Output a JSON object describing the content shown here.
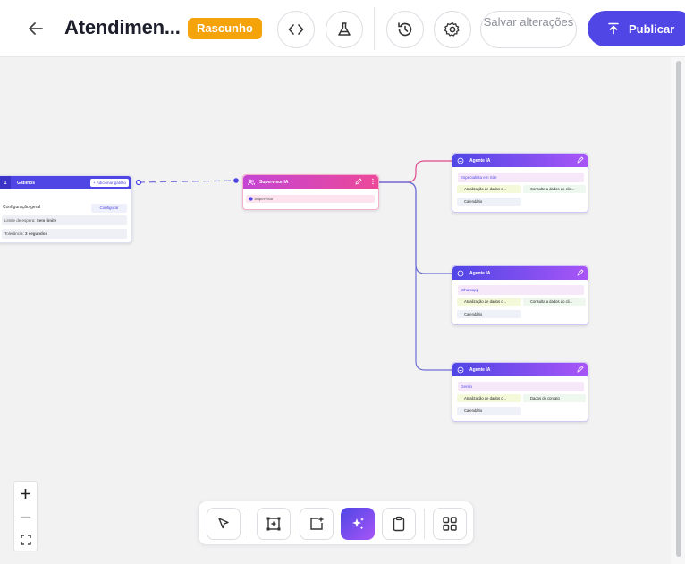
{
  "header": {
    "title": "Atendimen...",
    "status_badge": "Rascunho",
    "save_label": "Salvar alterações",
    "publish_label": "Publicar"
  },
  "trigger": {
    "number": "1",
    "title": "Gatilhos",
    "add_label": "+ Adicionar gatilho",
    "config_label": "Configuração geral",
    "config_button": "Configurar",
    "wait_label": "Limite de espera:",
    "wait_value": "Sem limite",
    "delay_label": "Tolerância:",
    "delay_value": "3 segundos"
  },
  "supervisor": {
    "title": "Supervisor IA",
    "pill": "Supervisor"
  },
  "agents": [
    {
      "title": "Agente IA",
      "pill": "Especialista em Site",
      "tool1": "Atualização de dados c...",
      "tool2": "Consulta a dados do clie...",
      "tool3": "Calendário"
    },
    {
      "title": "Agente IA",
      "pill": "Whatsapp",
      "tool1": "Atualização de dados c...",
      "tool2": "Consulta a dados do cli...",
      "tool3": "Calendário"
    },
    {
      "title": "Agente IA",
      "pill": "Genilo",
      "tool1": "Atualização de dados c...",
      "tool2": "Dados do contato",
      "tool3": "Calendário"
    }
  ],
  "colors": {
    "primary": "#4f46e5",
    "badge": "#f5a30a",
    "supervisor_from": "#c445d3",
    "supervisor_to": "#ec4899",
    "agent_to": "#a855f7"
  }
}
